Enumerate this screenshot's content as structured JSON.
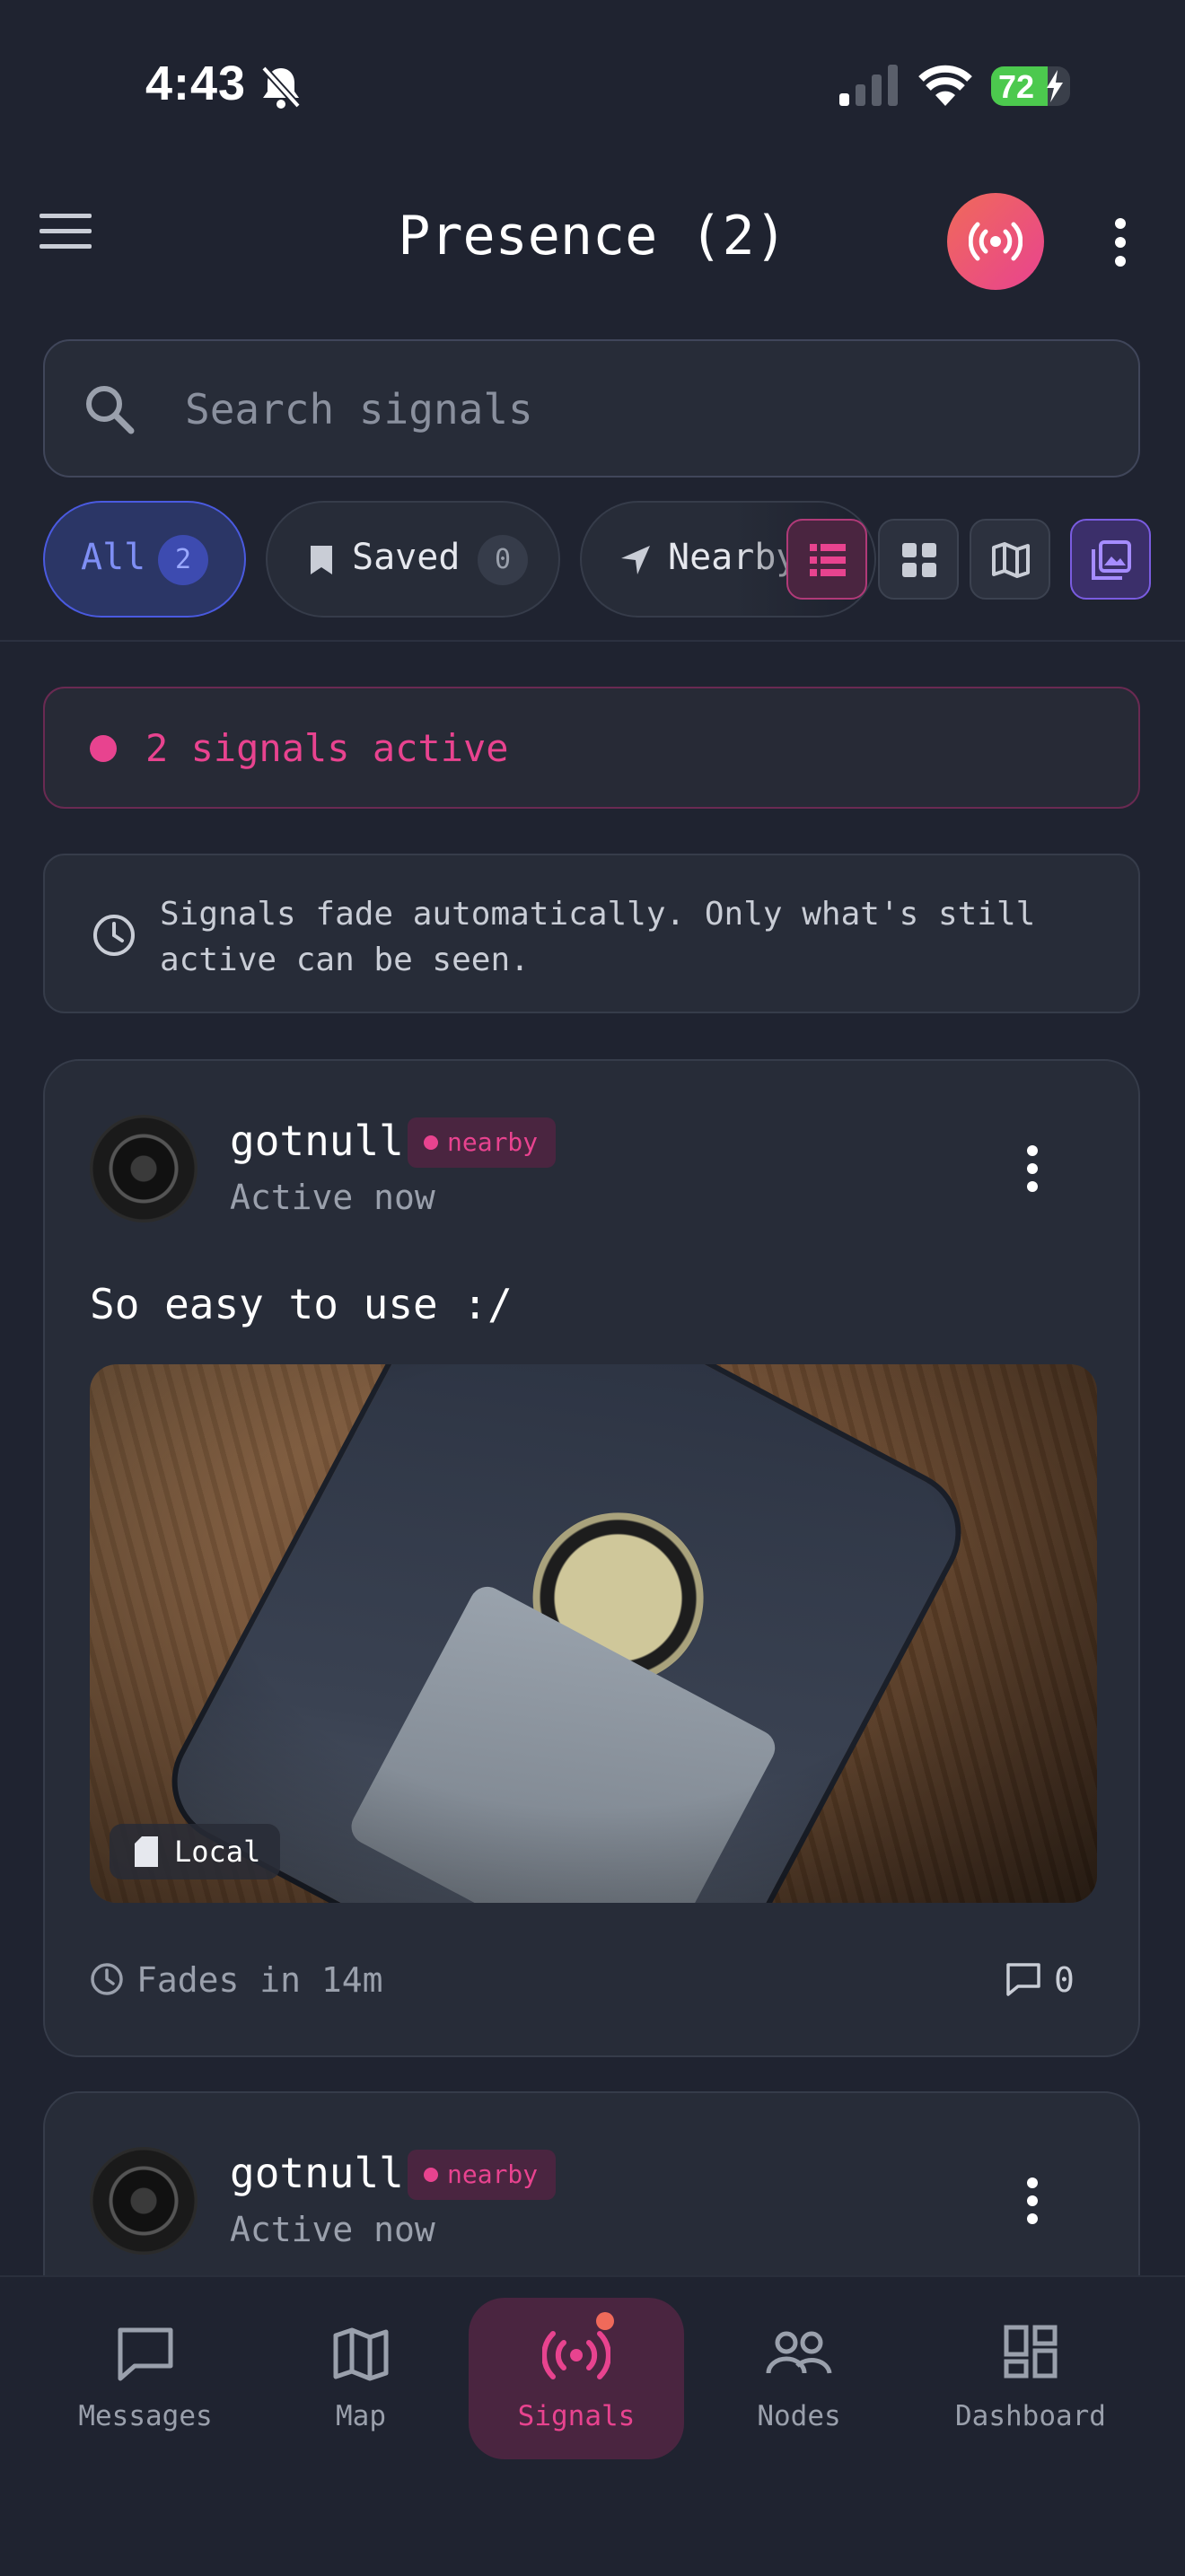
{
  "status_bar": {
    "time": "4:43",
    "battery": "72",
    "battery_level": 0.72,
    "icons": [
      "bell-slash-icon",
      "cellular-signal-icon",
      "wifi-icon",
      "battery-charging-icon"
    ]
  },
  "header": {
    "menu_icon": "hamburger-menu-icon",
    "title": "Presence (2)",
    "broadcast_icon": "broadcast-icon",
    "more_icon": "vertical-dots-icon"
  },
  "search": {
    "placeholder": "Search signals",
    "value": "",
    "icon": "search-icon"
  },
  "filters": [
    {
      "label": "All",
      "count": "2",
      "selected": true
    },
    {
      "label": "Saved",
      "count": "0",
      "icon": "bookmark-icon"
    },
    {
      "label": "Nearby",
      "icon": "navigation-arrow-icon"
    }
  ],
  "view_modes": [
    "list-view-icon",
    "grid-view-icon",
    "map-view-icon",
    "gallery-view-icon"
  ],
  "active_banner": "2 signals active",
  "info_banner": "Signals fade automatically. Only what's still\nactive can be seen.",
  "posts": [
    {
      "username": "gotnull",
      "badge": "nearby",
      "status": "Active now",
      "text": "So easy to use :/",
      "media_tag": "Local",
      "fades": "Fades in 14m",
      "comments": "0"
    },
    {
      "username": "gotnull",
      "badge": "nearby",
      "status": "Active now"
    }
  ],
  "bottom_nav": [
    {
      "label": "Messages",
      "icon": "message-square-icon"
    },
    {
      "label": "Map",
      "icon": "map-icon"
    },
    {
      "label": "Signals",
      "icon": "broadcast-icon",
      "active": true
    },
    {
      "label": "Nodes",
      "icon": "users-icon"
    },
    {
      "label": "Dashboard",
      "icon": "dashboard-icon"
    }
  ],
  "colors": {
    "background": "#1f2330",
    "accent": "#e8438f",
    "selected_chip": "#5b6ef0",
    "card": "#272c38"
  }
}
